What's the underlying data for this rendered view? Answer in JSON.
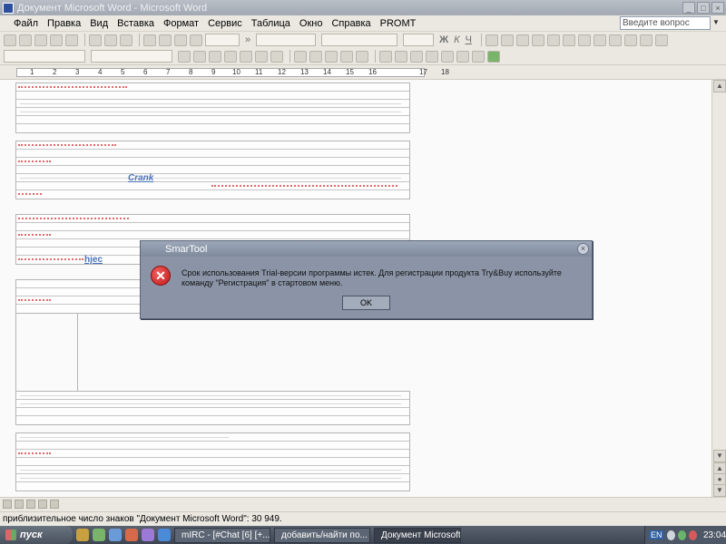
{
  "window": {
    "title": "Документ Microsoft Word - Microsoft Word"
  },
  "menu": {
    "items": [
      "Файл",
      "Правка",
      "Вид",
      "Вставка",
      "Формат",
      "Сервис",
      "Таблица",
      "Окно",
      "Справка",
      "PROMT"
    ],
    "ask_placeholder": "Введите вопрос"
  },
  "toolbar": {
    "zoom_label": "",
    "format_glyphs": [
      "Ж",
      "К",
      "Ч"
    ]
  },
  "ruler": {
    "ticks": [
      "1",
      "2",
      "3",
      "4",
      "5",
      "6",
      "7",
      "8",
      "9",
      "10",
      "11",
      "12",
      "13",
      "14",
      "15",
      "16",
      "17",
      "18"
    ]
  },
  "document": {
    "link_crank": "Crank",
    "link_hjec": "hjec"
  },
  "dialog": {
    "title": "SmarTool",
    "message": "Срок использования Trial-версии программы истек. Для регистрации продукта Try&Buy используйте команду \"Регистрация\" в стартовом меню.",
    "ok_label": "OK"
  },
  "statusbar": {
    "text": "приблизительное число знаков \"Документ Microsoft Word\": 30 949."
  },
  "taskbar": {
    "start_label": "пуск",
    "tasks": [
      {
        "label": "mIRC - [#Chat [6] [+..."
      },
      {
        "label": "добавить/найти по..."
      },
      {
        "label": "Документ Microsoft ..."
      }
    ],
    "tray": {
      "lang": "EN",
      "clock": "23:04"
    }
  },
  "colors": {
    "accent": "#8a94a6",
    "error": "#c01818",
    "link": "#4b73b6"
  }
}
